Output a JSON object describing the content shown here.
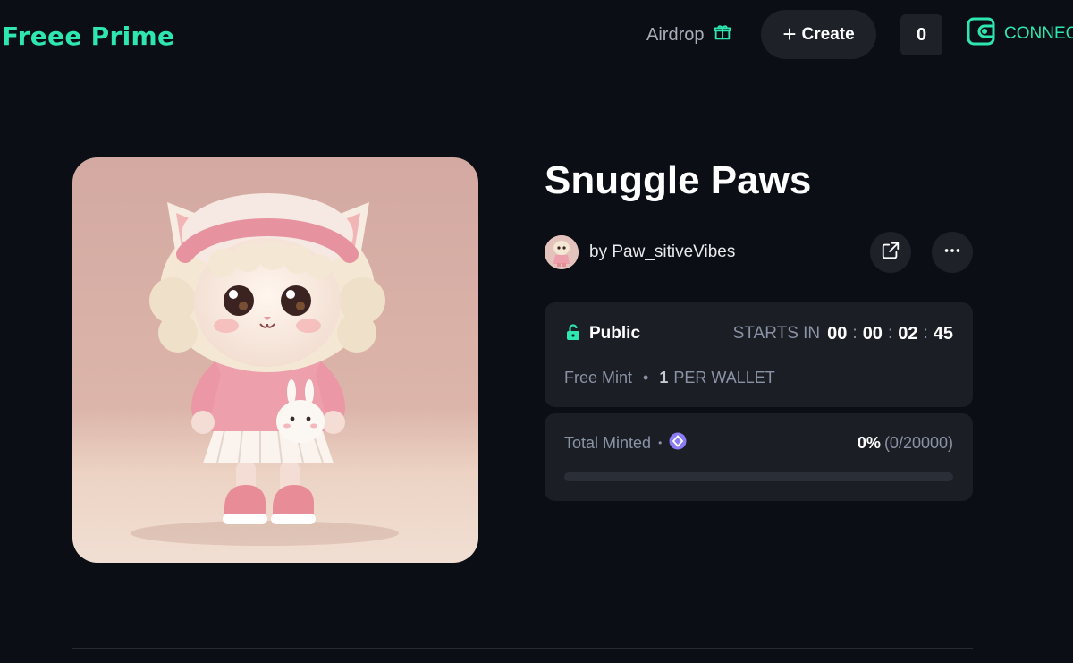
{
  "header": {
    "logo": "Freee Prime",
    "airdrop_label": "Airdrop",
    "create_label": "Create",
    "counter_value": "0",
    "connect_label": "CONNEC"
  },
  "collection": {
    "title": "Snuggle Paws",
    "creator": "by Paw_sitiveVibes"
  },
  "phase": {
    "name": "Public",
    "starts_label": "STARTS IN",
    "countdown": {
      "d": "00",
      "h": "00",
      "m": "02",
      "s": "45"
    },
    "price_label": "Free Mint",
    "per_wallet_count": "1",
    "per_wallet_label": "PER WALLET"
  },
  "minted": {
    "label": "Total Minted",
    "percent": "0%",
    "ratio": "(0/20000)",
    "progress_fraction": 0
  },
  "colors": {
    "accent": "#2ee6b0",
    "background": "#0b0e14",
    "card": "#1b1e25",
    "chain": "#8b7cf6"
  },
  "icons": {
    "airdrop": "gift-icon",
    "create": "plus-icon",
    "connect": "wallet-icon",
    "share": "external-link-icon",
    "more": "more-icon",
    "phase": "unlock-icon",
    "chain": "chain-icon"
  }
}
